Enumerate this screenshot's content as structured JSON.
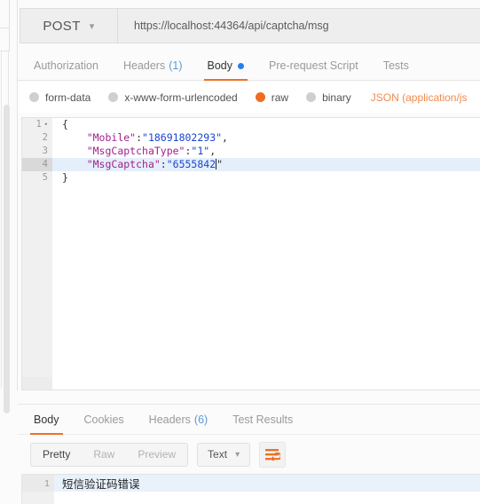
{
  "request": {
    "method": "POST",
    "method_chevron": "chevron-down-icon",
    "url": "https://localhost:44364/api/captcha/msg",
    "tabs": [
      {
        "label": "Authorization",
        "count": "",
        "active": false,
        "dot": false
      },
      {
        "label": "Headers",
        "count": "(1)",
        "active": false,
        "dot": false
      },
      {
        "label": "Body",
        "count": "",
        "active": true,
        "dot": true
      },
      {
        "label": "Pre-request Script",
        "count": "",
        "active": false,
        "dot": false
      },
      {
        "label": "Tests",
        "count": "",
        "active": false,
        "dot": false
      }
    ],
    "body_types": [
      {
        "label": "form-data",
        "selected": false
      },
      {
        "label": "x-www-form-urlencoded",
        "selected": false
      },
      {
        "label": "raw",
        "selected": true
      },
      {
        "label": "binary",
        "selected": false
      }
    ],
    "content_type": "JSON (application/js",
    "editor": {
      "lines": [
        {
          "num": "1",
          "fold": "▾",
          "highlight": false,
          "punc_open": "{",
          "key": "",
          "colon": "",
          "value": "",
          "comma": ""
        },
        {
          "num": "2",
          "fold": "",
          "highlight": false,
          "punc_open": "",
          "key": "\"Mobile\"",
          "colon": ":",
          "value": "\"18691802293\"",
          "comma": ","
        },
        {
          "num": "3",
          "fold": "",
          "highlight": false,
          "punc_open": "",
          "key": "\"MsgCaptchaType\"",
          "colon": ":",
          "value": "\"1\"",
          "comma": ","
        },
        {
          "num": "4",
          "fold": "",
          "highlight": true,
          "punc_open": "",
          "key": "\"MsgCaptcha\"",
          "colon": ":",
          "value": "\"6555842",
          "comma": "\""
        },
        {
          "num": "5",
          "fold": "",
          "highlight": false,
          "punc_open": "}",
          "key": "",
          "colon": "",
          "value": "",
          "comma": ""
        }
      ]
    }
  },
  "response": {
    "tabs": [
      {
        "label": "Body",
        "count": "",
        "active": true
      },
      {
        "label": "Cookies",
        "count": "",
        "active": false
      },
      {
        "label": "Headers",
        "count": "(6)",
        "active": false
      },
      {
        "label": "Test Results",
        "count": "",
        "active": false
      }
    ],
    "view_modes": [
      {
        "label": "Pretty",
        "active": true
      },
      {
        "label": "Raw",
        "active": false
      },
      {
        "label": "Preview",
        "active": false
      }
    ],
    "format": "Text",
    "format_chevron": "chevron-down-icon",
    "wrap_icon": "word-wrap-icon",
    "body": {
      "line_number": "1",
      "text": "短信验证码错误"
    }
  },
  "colors": {
    "accent_orange": "#ef7025",
    "blue_dot": "#2680eb",
    "json_key": "#a11f8e",
    "json_value": "#1a45cf",
    "active_line": "#e4effb"
  }
}
